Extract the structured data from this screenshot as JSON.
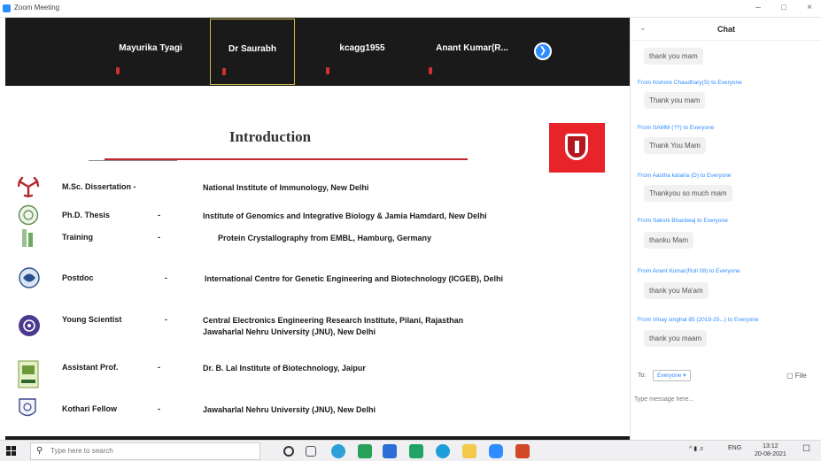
{
  "window": {
    "title": "Zoom Meeting",
    "minimize": "–",
    "maximize": "□",
    "close": "×"
  },
  "participants": [
    {
      "name": "Mayurika Tyagi",
      "muted": true
    },
    {
      "name": "Dr Saurabh",
      "muted": true,
      "active": true
    },
    {
      "name": "kcagg1955",
      "muted": true
    },
    {
      "name": "Anant  Kumar(R...",
      "muted": true
    }
  ],
  "next_icon": "chevron-right-icon",
  "slide": {
    "title": "Introduction",
    "rows": [
      {
        "role": "M.Sc. Dissertation -",
        "dash": "",
        "institution": "National Institute of Immunology, New Delhi",
        "icon": "immunology-icon"
      },
      {
        "role": "Ph.D. Thesis",
        "dash": "-",
        "institution": "Institute of  Genomics and  Integrative Biology & Jamia Hamdard, New Delhi",
        "icon": "jamia-hamdard-icon"
      },
      {
        "role": "Training",
        "dash": "-",
        "institution": "Protein Crystallography from EMBL, Hamburg, Germany",
        "icon": "embl-icon"
      },
      {
        "role": "Postdoc",
        "dash": "-",
        "institution": "International Centre for Genetic Engineering and Biotechnology (ICGEB), Delhi",
        "icon": "icgeb-icon"
      },
      {
        "role": "Young Scientist",
        "dash": "-",
        "institution": "Central Electronics Engineering Research Institute, Pilani, Rajasthan",
        "institution2": "Jawaharlal Nehru University (JNU), New Delhi",
        "icon": "ceeri-icon"
      },
      {
        "role": "Assistant Prof.",
        "dash": "-",
        "institution": "Dr. B. Lal Institute of Biotechnology, Jaipur",
        "icon": "blal-icon"
      },
      {
        "role": "Kothari Fellow",
        "dash": "-",
        "institution": "Jawaharlal Nehru University (JNU), New Delhi",
        "icon": "jnu-icon"
      }
    ]
  },
  "chat": {
    "title": "Chat",
    "messages": [
      {
        "from": "",
        "text": "thank you mam"
      },
      {
        "from": "From Kishore Chaudhary(S) to Everyone",
        "text": "Thank you mam"
      },
      {
        "from": "From SAMM (??) to Everyone",
        "text": "Thank You Mam"
      },
      {
        "from": "From Aastha kataria (D) to Everyone",
        "text": "Thankyou so much mam"
      },
      {
        "from": "From Sakshi Bhardwaj to Everyone",
        "text": "thanku Mam"
      },
      {
        "from": "From Anant Kumar(Roll 08) to Everyone",
        "text": "thank you Ma'am"
      },
      {
        "from": "From Vinay singhal 85 (2019-20...) to Everyone",
        "text": "thank you maam"
      }
    ],
    "to_label": "To:",
    "to_value": "Everyone ▾",
    "file_label": "File",
    "input_placeholder": "Type message here..."
  },
  "taskbar": {
    "search_placeholder": "Type here to search",
    "tray_lang": "ENG",
    "tray_time": "13:12",
    "tray_date": "20-08-2021"
  }
}
